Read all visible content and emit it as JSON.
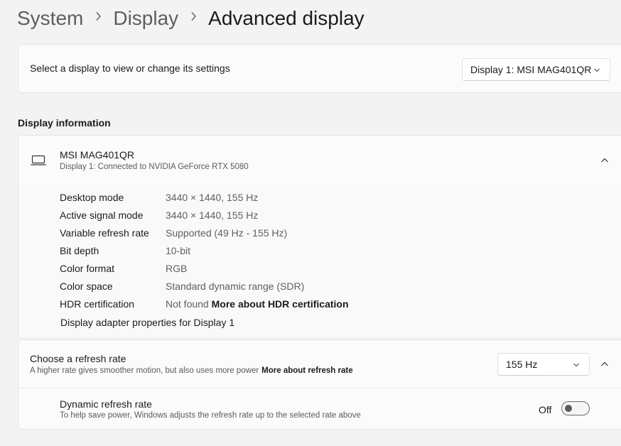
{
  "breadcrumb": {
    "items": [
      "System",
      "Display"
    ],
    "current": "Advanced display"
  },
  "display_select": {
    "label": "Select a display to view or change its settings",
    "selected": "Display 1: MSI MAG401QR"
  },
  "display_info": {
    "section_title": "Display information",
    "name": "MSI MAG401QR",
    "subtitle": "Display 1: Connected to NVIDIA GeForce RTX 5080",
    "rows": [
      {
        "label": "Desktop mode",
        "value": "3440 × 1440, 155 Hz"
      },
      {
        "label": "Active signal mode",
        "value": "3440 × 1440, 155 Hz"
      },
      {
        "label": "Variable refresh rate",
        "value": "Supported (49 Hz - 155 Hz)"
      },
      {
        "label": "Bit depth",
        "value": "10-bit"
      },
      {
        "label": "Color format",
        "value": "RGB"
      },
      {
        "label": "Color space",
        "value": "Standard dynamic range (SDR)"
      },
      {
        "label": "HDR certification",
        "value": "Not found",
        "link": "More about HDR certification"
      }
    ],
    "adapter_link": "Display adapter properties for Display 1"
  },
  "refresh_rate": {
    "title": "Choose a refresh rate",
    "subtitle": "A higher rate gives smoother motion, but also uses more power",
    "link": "More about refresh rate",
    "selected": "155 Hz",
    "dynamic": {
      "title": "Dynamic refresh rate",
      "subtitle": "To help save power, Windows adjusts the refresh rate up to the selected rate above",
      "state_label": "Off",
      "enabled": false
    }
  },
  "icons": {
    "breadcrumb_separator": "chevron-right-icon",
    "dropdown": "chevron-down-icon",
    "collapse": "chevron-up-icon",
    "monitor": "laptop-icon"
  }
}
